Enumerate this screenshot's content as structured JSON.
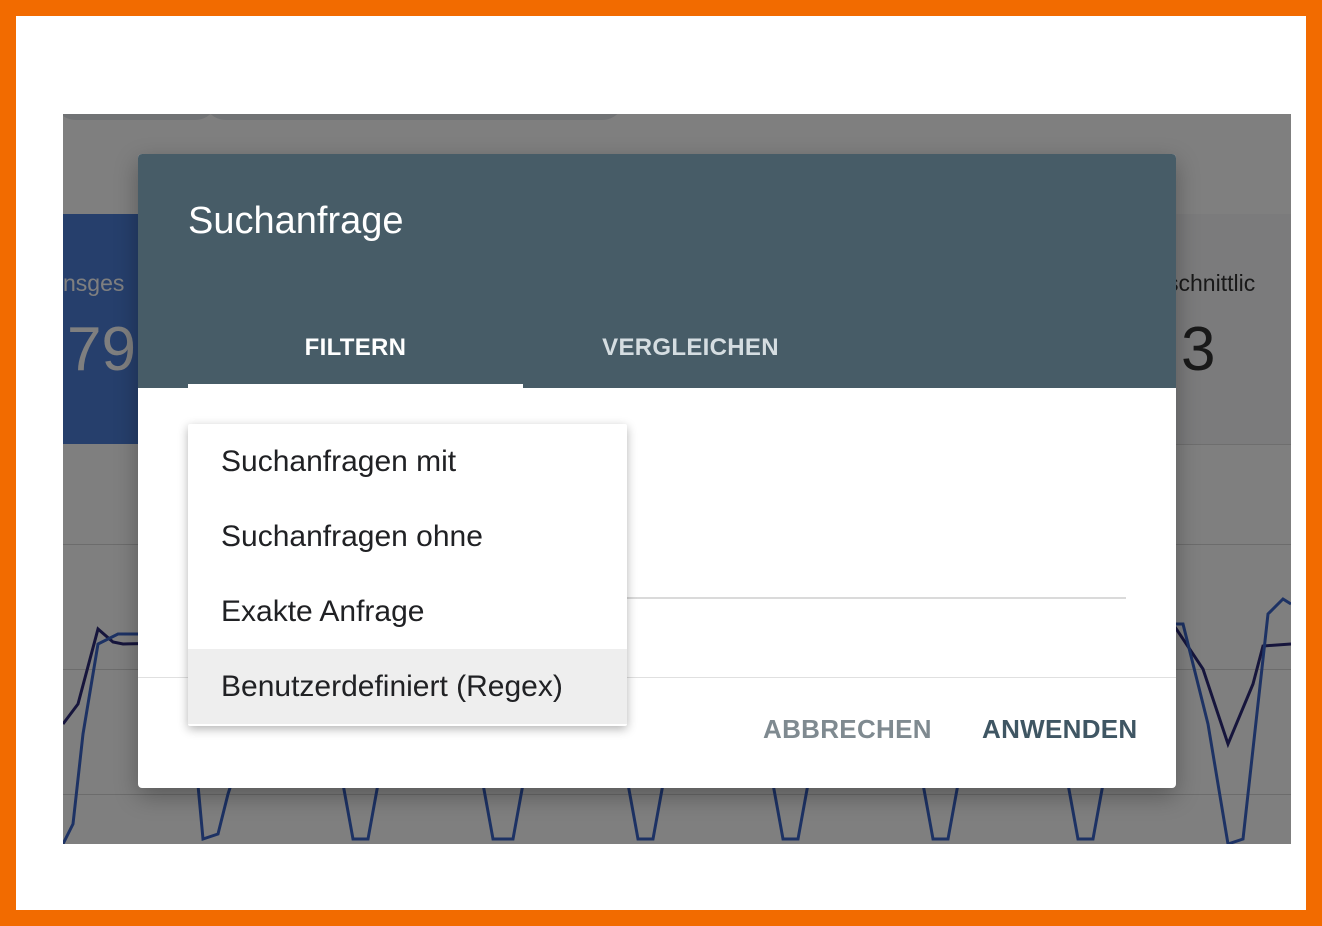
{
  "background": {
    "metric_left_label": "nsges",
    "metric_left_value": "79",
    "metric_right_label": "schnittlic",
    "metric_right_value": "3"
  },
  "dialog": {
    "title": "Suchanfrage",
    "tabs": [
      {
        "label": "FILTERN",
        "active": true
      },
      {
        "label": "VERGLEICHEN",
        "active": false
      }
    ],
    "menu": {
      "items": [
        {
          "label": "Suchanfragen mit",
          "selected": false
        },
        {
          "label": "Suchanfragen ohne",
          "selected": false
        },
        {
          "label": "Exakte Anfrage",
          "selected": false
        },
        {
          "label": "Benutzerdefiniert (Regex)",
          "selected": true
        }
      ]
    },
    "buttons": {
      "cancel": "ABBRECHEN",
      "apply": "ANWENDEN"
    }
  },
  "colors": {
    "frame_border": "#f26b00",
    "dialog_header": "#475c67",
    "accent_blue": "#4d7fd9"
  }
}
